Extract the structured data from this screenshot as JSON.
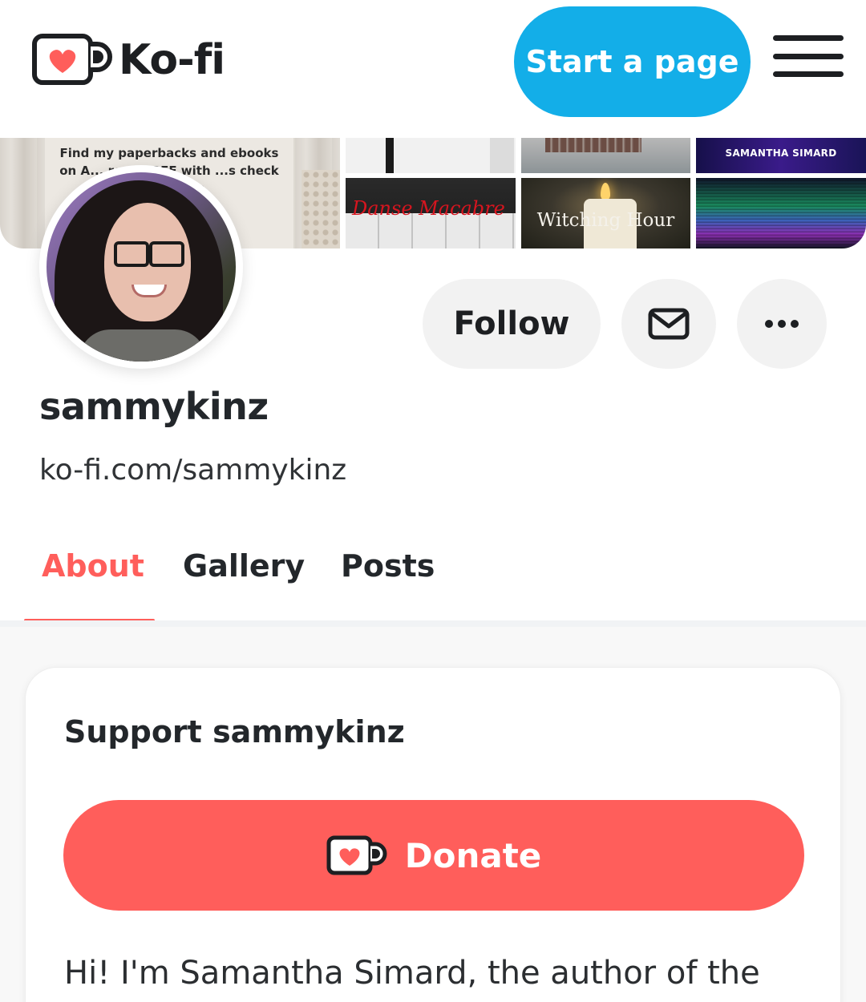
{
  "header": {
    "logo_text": "Ko-fi",
    "start_label": "Start a page"
  },
  "banner": {
    "tile1_text": "Find my paperbacks and ebooks on A... read FREE with ...s check out ...sives.",
    "tile2_text": "Danse Macabre",
    "tile3_text": "Witching Hour",
    "tile4_text": "SAMANTHA SIMARD"
  },
  "profile": {
    "follow_label": "Follow",
    "username": "sammykinz",
    "url": "ko-fi.com/sammykinz"
  },
  "tabs": [
    {
      "label": "About",
      "active": true
    },
    {
      "label": "Gallery",
      "active": false
    },
    {
      "label": "Posts",
      "active": false
    }
  ],
  "support": {
    "title": "Support sammykinz",
    "donate_label": "Donate",
    "bio": "Hi! I'm Samantha Simard, the author of the"
  },
  "colors": {
    "brand_blue": "#13aee8",
    "brand_red": "#ff5e5b"
  },
  "icons": [
    "kofi-mug-icon",
    "hamburger-menu-icon",
    "mail-icon",
    "more-dots-icon"
  ]
}
